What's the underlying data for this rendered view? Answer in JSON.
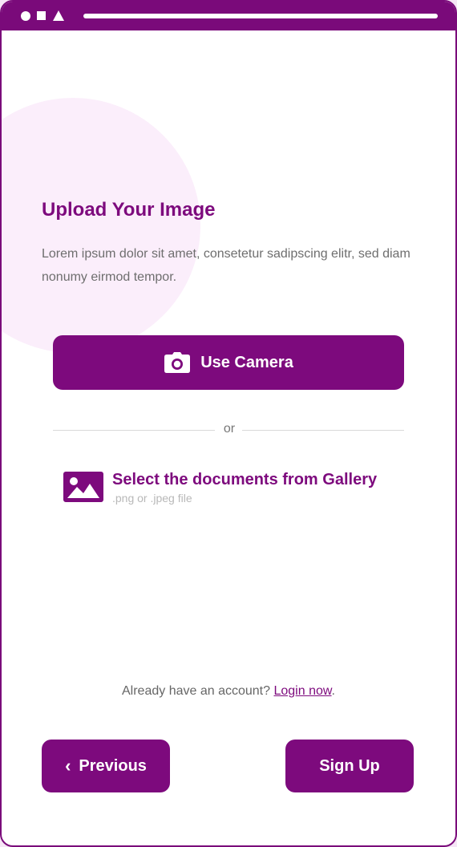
{
  "header": {
    "dot_icon": "circle-icon",
    "square_icon": "square-icon",
    "triangle_icon": "triangle-icon"
  },
  "main": {
    "title": "Upload Your Image",
    "description": "Lorem ipsum dolor sit amet, consetetur sadipscing elitr, sed diam nonumy eirmod tempor.",
    "camera_button": {
      "label": "Use Camera",
      "icon": "camera-icon"
    },
    "divider_text": "or",
    "gallery": {
      "title": "Select the documents from Gallery",
      "subtitle": ".png or .jpeg file",
      "icon": "image-icon"
    }
  },
  "footer": {
    "login_prompt": "Already have an account?",
    "login_link": "Login now",
    "login_suffix": ".",
    "previous_label": "Previous",
    "signup_label": "Sign Up"
  },
  "colors": {
    "brand": "#7d0a7d",
    "frame": "#7a0a7a",
    "background_blob": "#fbeefb",
    "text_muted": "#6e6e6e"
  }
}
